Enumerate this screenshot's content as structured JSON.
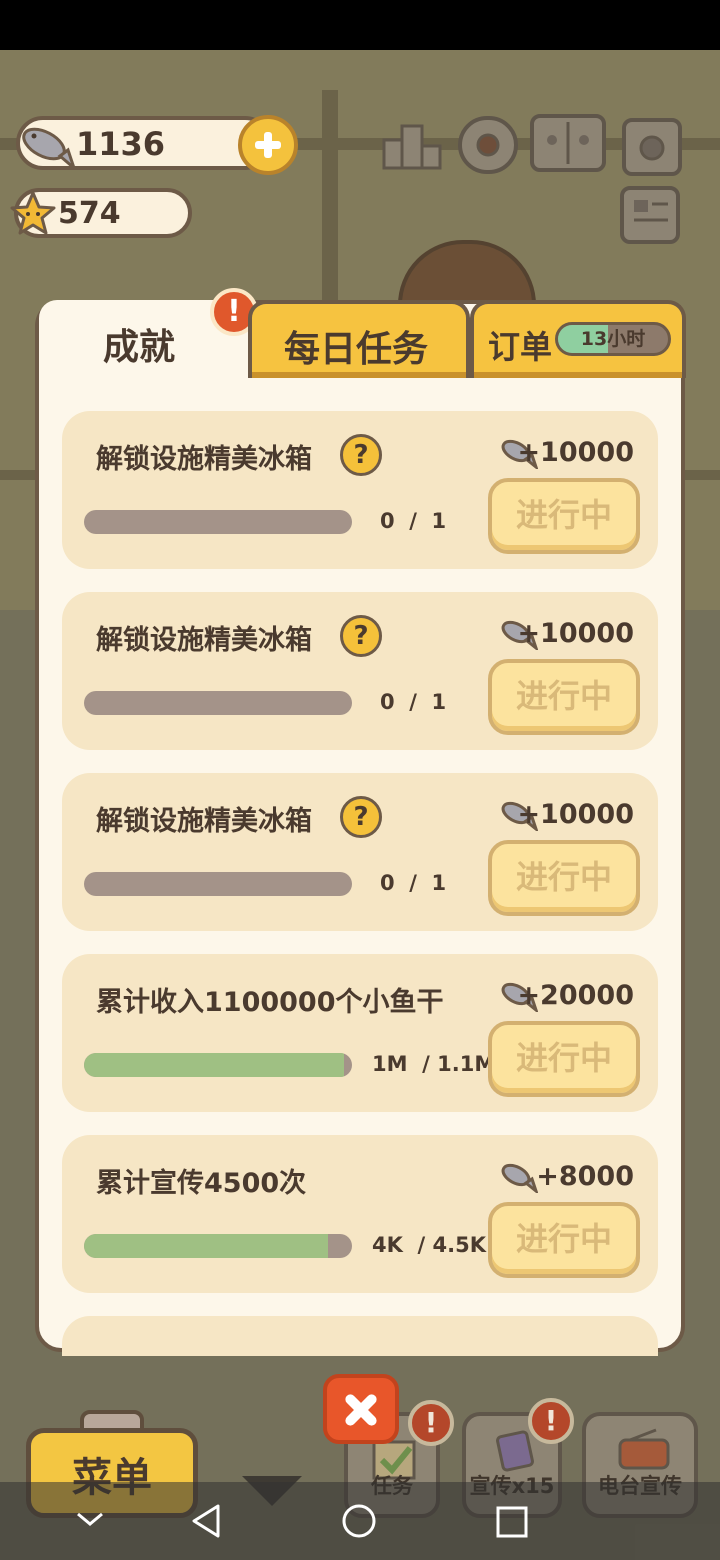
{
  "hud": {
    "fish_count": "1136",
    "star_count": "574",
    "icons": [
      "ranking-icon",
      "settings-gear-icon",
      "paw-book-icon",
      "camera-icon",
      "newspaper-icon"
    ]
  },
  "tabs": {
    "achievements": "成就",
    "daily": "每日任务",
    "orders": "订单",
    "order_timer": "13小时",
    "order_timer_level": 0.45,
    "achievements_badge": "!"
  },
  "cards": [
    {
      "title": "解锁设施精美冰箱",
      "has_help": true,
      "help": "?",
      "reward": "+10000",
      "progress_text": "0  /  1",
      "progress_level": 0,
      "button": "进行中"
    },
    {
      "title": "解锁设施精美冰箱",
      "has_help": true,
      "help": "?",
      "reward": "+10000",
      "progress_text": "0  /  1",
      "progress_level": 0,
      "button": "进行中"
    },
    {
      "title": "解锁设施精美冰箱",
      "has_help": true,
      "help": "?",
      "reward": "+10000",
      "progress_text": "0  /  1",
      "progress_level": 0,
      "button": "进行中"
    },
    {
      "title": "累计收入1100000个小鱼干",
      "has_help": false,
      "reward": "+20000",
      "progress_text": "1M  / 1.1M",
      "progress_level": 0.97,
      "button": "进行中"
    },
    {
      "title": "累计宣传4500次",
      "has_help": false,
      "reward": "+8000",
      "progress_text": "4K  / 4.5K",
      "progress_level": 0.91,
      "button": "进行中"
    }
  ],
  "bottom": {
    "menu": "菜单",
    "tasks": "任务",
    "promote": "宣传x15",
    "radio": "电台宣传",
    "badge": "!"
  },
  "colors": {
    "accent_yellow": "#f6c340",
    "panel_bg": "#fdf7ea",
    "card_bg": "#f6e6c5",
    "progress_green": "#9fc083",
    "alert_orange": "#e0582c",
    "outline_brown": "#6d5a47"
  }
}
